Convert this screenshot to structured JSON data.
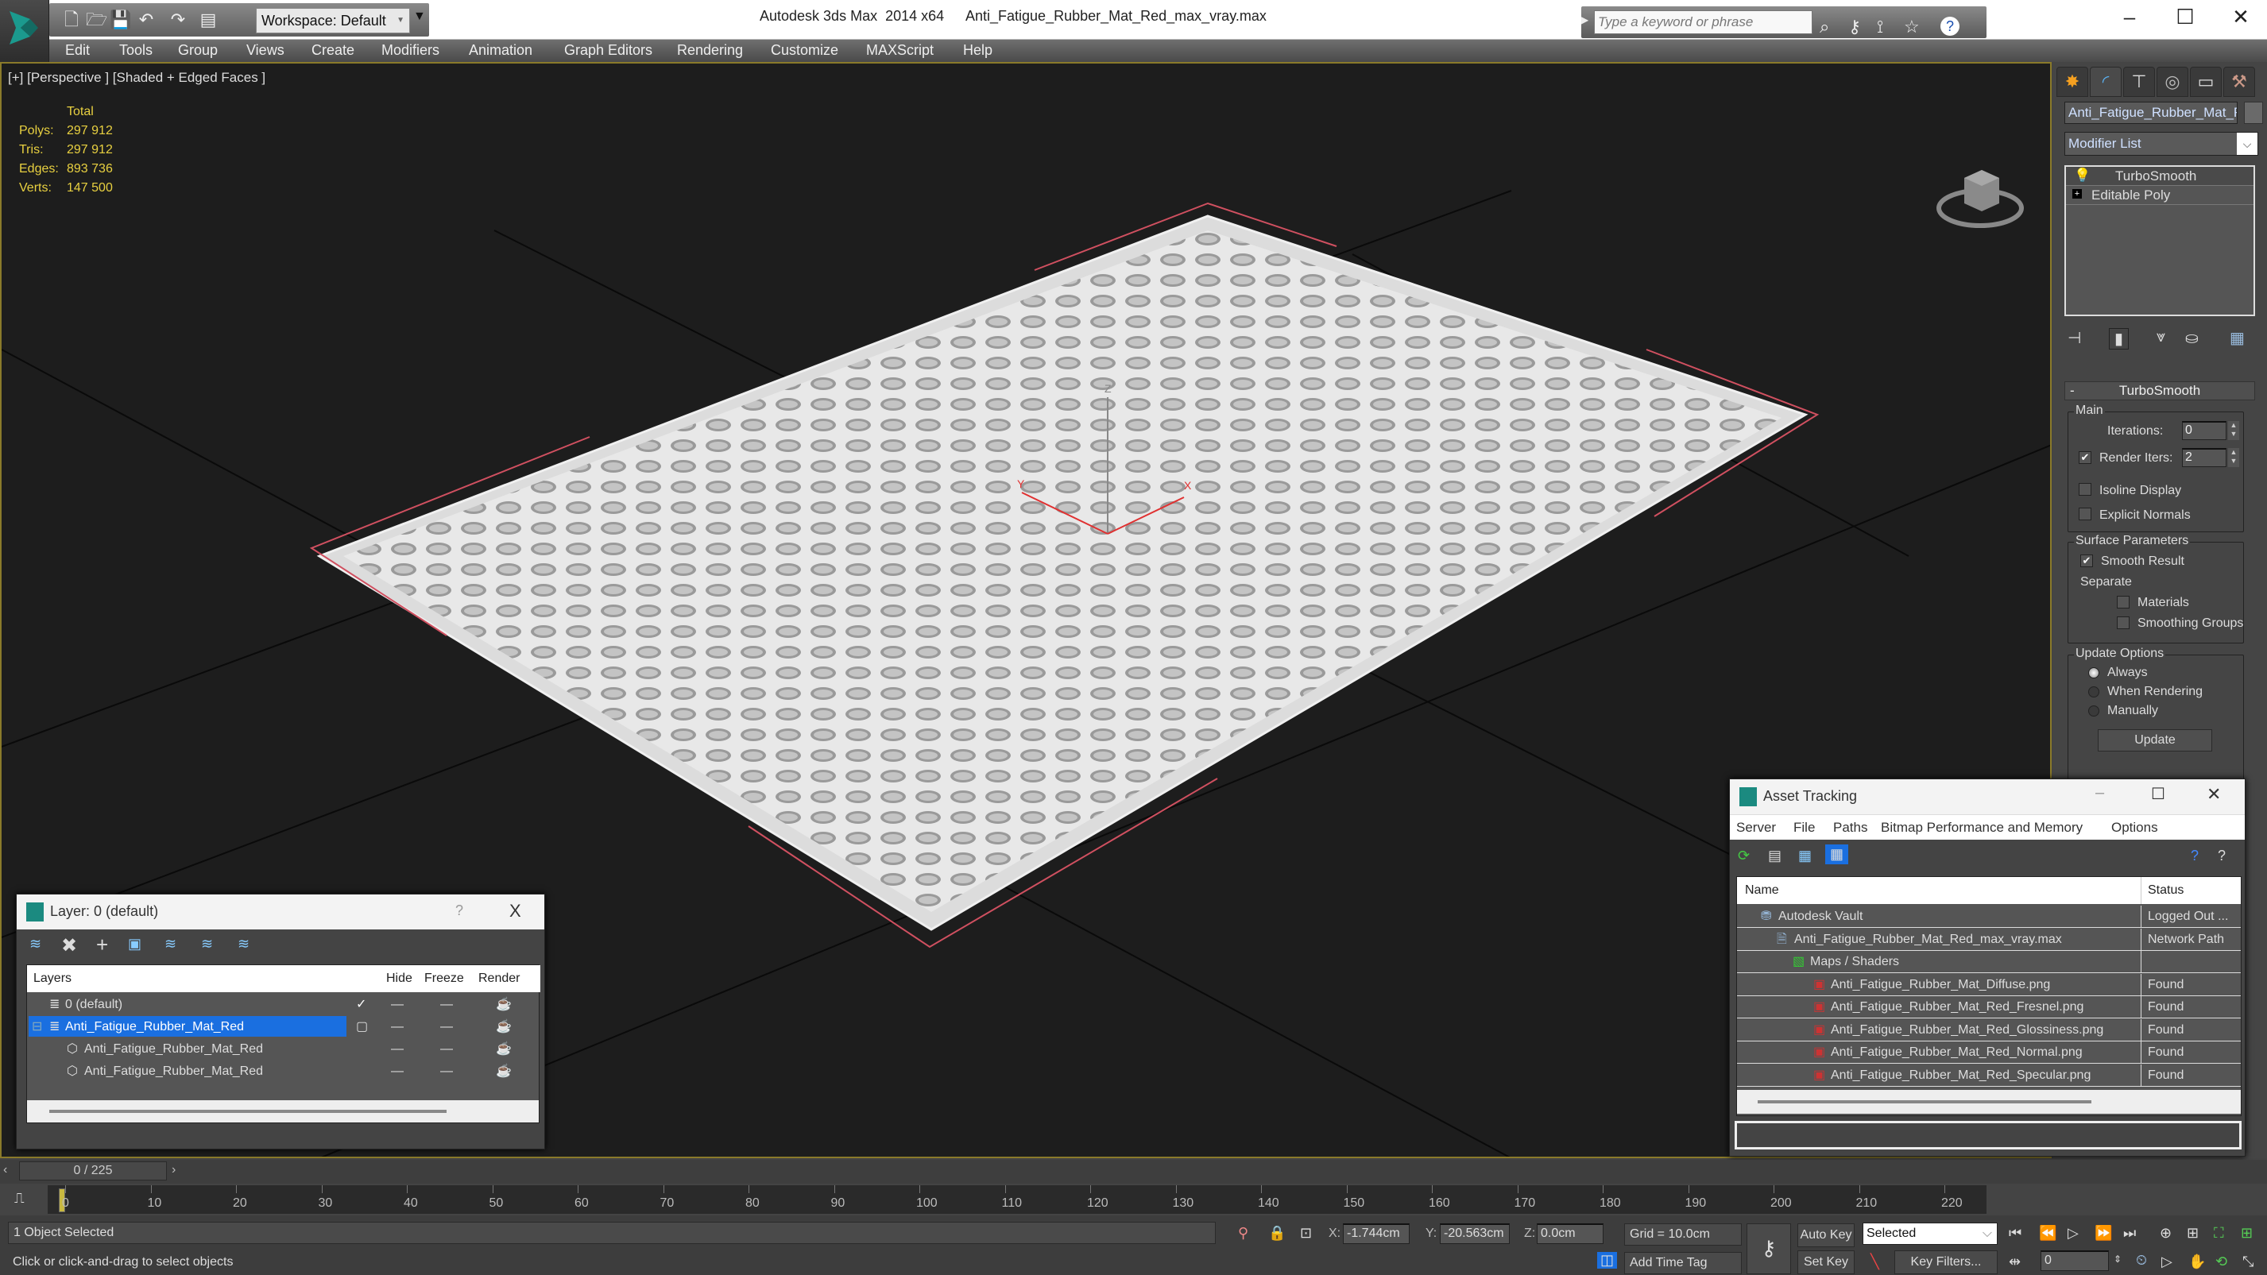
{
  "app": {
    "product": "Autodesk 3ds Max  2014 x64",
    "file": "Anti_Fatigue_Rubber_Mat_Red_max_vray.max",
    "workspace": "Workspace: Default",
    "search_placeholder": "Type a keyword or phrase"
  },
  "menu": [
    "Edit",
    "Tools",
    "Group",
    "Views",
    "Create",
    "Modifiers",
    "Animation",
    "Graph Editors",
    "Rendering",
    "Customize",
    "MAXScript",
    "Help"
  ],
  "viewport": {
    "label": "[+] [Perspective ] [Shaded + Edged Faces ]",
    "stats": {
      "header": "Total",
      "rows": [
        {
          "label": "Polys:",
          "value": "297 912"
        },
        {
          "label": "Tris:",
          "value": "297 912"
        },
        {
          "label": "Edges:",
          "value": "893 736"
        },
        {
          "label": "Verts:",
          "value": "147 500"
        }
      ]
    },
    "gizmo": {
      "x": "X",
      "y": "Y",
      "z": "Z"
    }
  },
  "command_panel": {
    "object_name": "Anti_Fatigue_Rubber_Mat_Red",
    "modifier_list": "Modifier List",
    "stack": [
      "TurboSmooth",
      "Editable Poly"
    ],
    "turbosmooth": {
      "title": "TurboSmooth",
      "collapse": "-",
      "main_label": "Main",
      "iterations_label": "Iterations:",
      "iterations": "0",
      "render_iters_label": "Render Iters:",
      "render_iters": "2",
      "render_iters_checked": true,
      "isoline_label": "Isoline Display",
      "explicit_normals_label": "Explicit Normals",
      "surface_label": "Surface Parameters",
      "smooth_result_label": "Smooth Result",
      "separate_label": "Separate",
      "materials_label": "Materials",
      "smoothing_groups_label": "Smoothing Groups",
      "update_options_label": "Update Options",
      "always_label": "Always",
      "when_rendering_label": "When Rendering",
      "manually_label": "Manually",
      "update_button": "Update",
      "selected_update_option": "Always"
    }
  },
  "layer_dialog": {
    "title": "Layer: 0 (default)",
    "help": "?",
    "close": "X",
    "columns": [
      "Layers",
      "Hide",
      "Freeze",
      "Render"
    ],
    "rows": [
      {
        "name": "0 (default)",
        "active": true
      },
      {
        "name": "Anti_Fatigue_Rubber_Mat_Red",
        "selected": true
      },
      {
        "name": "Anti_Fatigue_Rubber_Mat_Red"
      },
      {
        "name": "Anti_Fatigue_Rubber_Mat_Red"
      }
    ]
  },
  "asset_tracking": {
    "title": "Asset Tracking",
    "menu": [
      "Server",
      "File",
      "Paths",
      "Bitmap Performance and Memory",
      "Options"
    ],
    "columns": [
      "Name",
      "Status"
    ],
    "rows": [
      {
        "name": "Autodesk Vault",
        "status": "Logged Out ..."
      },
      {
        "name": "Anti_Fatigue_Rubber_Mat_Red_max_vray.max",
        "status": "Network Path"
      },
      {
        "name": "Maps / Shaders",
        "status": ""
      },
      {
        "name": "Anti_Fatigue_Rubber_Mat_Diffuse.png",
        "status": "Found"
      },
      {
        "name": "Anti_Fatigue_Rubber_Mat_Red_Fresnel.png",
        "status": "Found"
      },
      {
        "name": "Anti_Fatigue_Rubber_Mat_Red_Glossiness.png",
        "status": "Found"
      },
      {
        "name": "Anti_Fatigue_Rubber_Mat_Red_Normal.png",
        "status": "Found"
      },
      {
        "name": "Anti_Fatigue_Rubber_Mat_Red_Specular.png",
        "status": "Found"
      }
    ]
  },
  "timeline": {
    "frame": "0 / 225",
    "ticks": [
      "0",
      "10",
      "20",
      "30",
      "40",
      "50",
      "60",
      "70",
      "80",
      "90",
      "100",
      "110",
      "120",
      "130",
      "140",
      "150",
      "160",
      "170",
      "180",
      "190",
      "200",
      "210",
      "220"
    ]
  },
  "status": {
    "selection": "1 Object Selected",
    "prompt": "Click or click-and-drag to select objects",
    "x_label": "X:",
    "x": "-1.744cm",
    "y_label": "Y:",
    "y": "-20.563cm",
    "z_label": "Z:",
    "z": "0.0cm",
    "grid": "Grid = 10.0cm",
    "add_time_tag": "Add Time Tag",
    "auto_key": "Auto Key",
    "set_key": "Set Key",
    "key_mode": "Selected",
    "key_filters": "Key Filters...",
    "current_frame": "0"
  }
}
